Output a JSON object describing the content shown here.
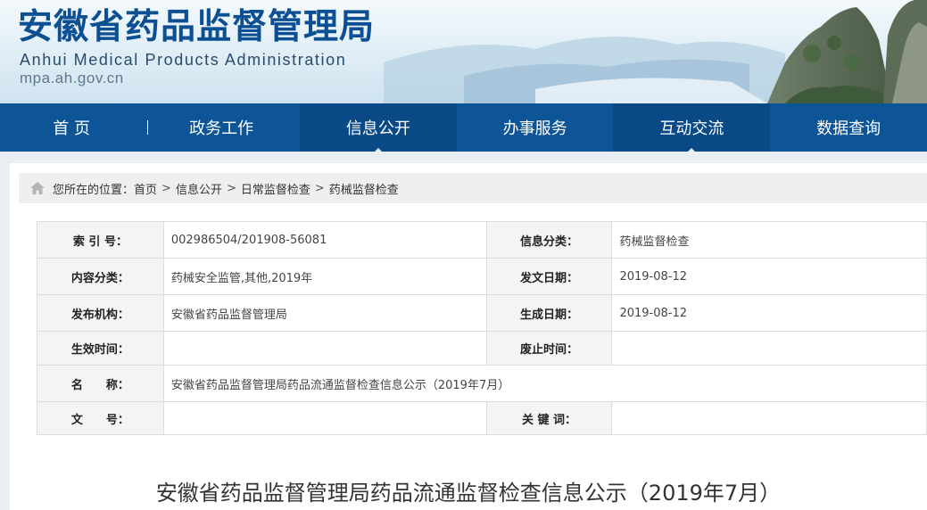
{
  "header": {
    "logo_cn": "安徽省药品监督管理局",
    "logo_en": "Anhui Medical Products Administration",
    "domain": "mpa.ah.gov.cn"
  },
  "nav": {
    "items": [
      {
        "label": "首 页"
      },
      {
        "label": "政务工作"
      },
      {
        "label": "信息公开"
      },
      {
        "label": "办事服务"
      },
      {
        "label": "互动交流"
      },
      {
        "label": "数据查询"
      }
    ]
  },
  "breadcrumb": {
    "prefix": "您所在的位置：",
    "items": [
      {
        "label": "首页"
      },
      {
        "label": "信息公开"
      },
      {
        "label": "日常监督检查"
      },
      {
        "label": "药械监督检查"
      }
    ],
    "separator": ">",
    "home_icon": "home-icon"
  },
  "info_table": {
    "index_no_label": "索 引 号：",
    "index_no_value": "002986504/201908-56081",
    "info_category_label": "信息分类：",
    "info_category_value": "药械监督检查",
    "content_category_label": "内容分类：",
    "content_category_value": "药械安全监管,其他,2019年",
    "issue_date_label": "发文日期：",
    "issue_date_value": "2019-08-12",
    "publisher_label": "发布机构：",
    "publisher_value": "安徽省药品监督管理局",
    "created_date_label": "生成日期：",
    "created_date_value": "2019-08-12",
    "effective_time_label": "生效时间：",
    "effective_time_value": "",
    "abolish_time_label": "废止时间：",
    "abolish_time_value": "",
    "name_label": "名　　称：",
    "name_value": "安徽省药品监督管理局药品流通监督检查信息公示（2019年7月）",
    "doc_no_label": "文　　号：",
    "doc_no_value": "",
    "keywords_label": "关 键 词：",
    "keywords_value": ""
  },
  "article": {
    "title": "安徽省药品监督管理局药品流通监督检查信息公示（2019年7月）"
  },
  "colors": {
    "nav_bg": "#0d5597",
    "nav_active_bg": "#094a86",
    "logo_blue": "#0c4f92",
    "page_bg": "#e9eef3"
  }
}
